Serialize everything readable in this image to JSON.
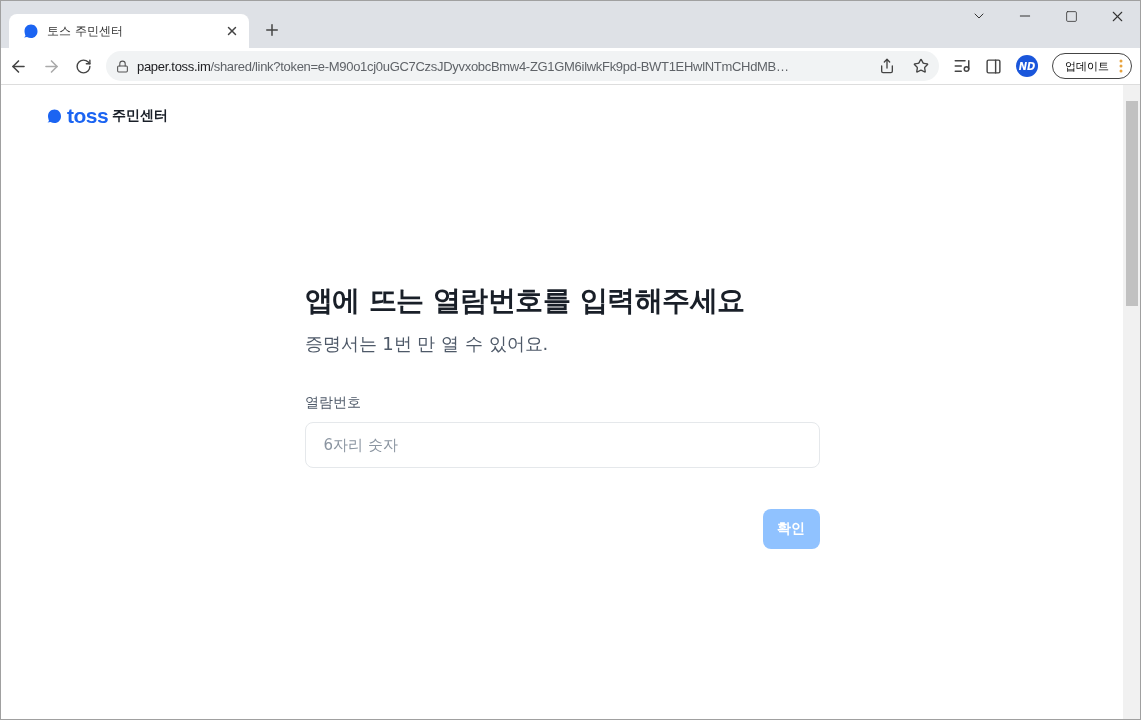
{
  "tab": {
    "title": "토스 주민센터",
    "selected": true
  },
  "address_bar": {
    "host": "paper.toss.im",
    "path": "/shared/link?token=e-M90o1cj0uGC7CzsJDyvxobcBmw4-ZG1GM6ilwkFk9pd-BWT1EHwlNTmCHdMB…"
  },
  "profile": {
    "initials": "ND"
  },
  "update_button": {
    "label": "업데이트"
  },
  "logo": {
    "wordmark": "toss",
    "suffix": "주민센터"
  },
  "heading": "앱에 뜨는 열람번호를 입력해주세요",
  "subheading": "증명서는 1번 만 열 수 있어요.",
  "field": {
    "label": "열람번호",
    "placeholder": "6자리 숫자"
  },
  "confirm_button": {
    "label": "확인",
    "disabled": true
  }
}
